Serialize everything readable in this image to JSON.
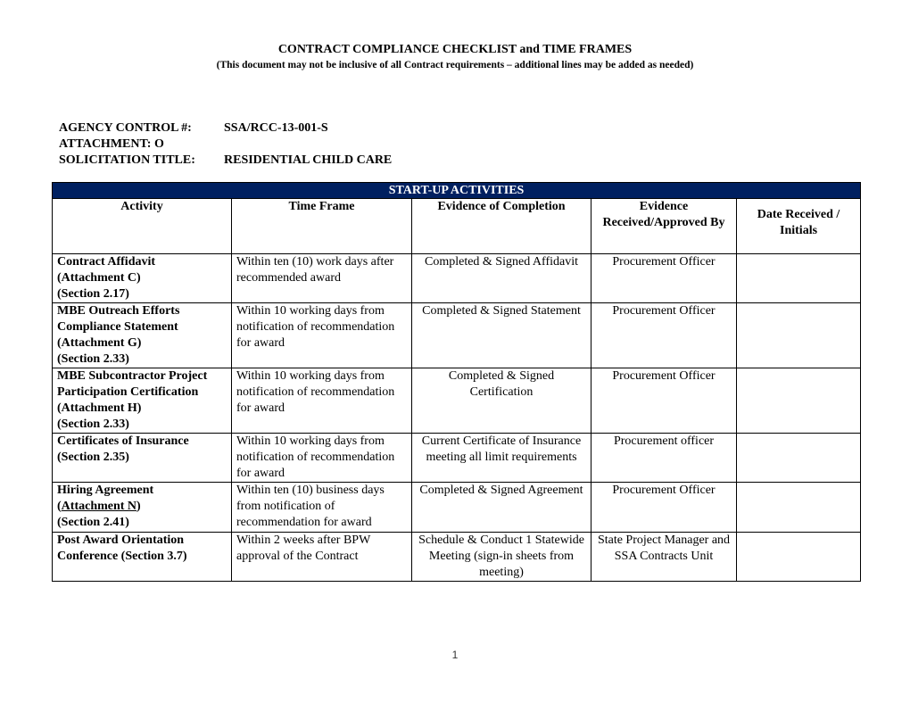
{
  "document": {
    "title": "CONTRACT COMPLIANCE CHECKLIST and TIME FRAMES",
    "subtitle": "(This document may not be inclusive of all Contract requirements – additional lines may be added as needed)",
    "page_number": "1"
  },
  "meta": {
    "agency_control_label": "AGENCY CONTROL #:",
    "agency_control_value": "SSA/RCC-13-001-S",
    "attachment_label": "ATTACHMENT: O",
    "solicitation_title_label": "SOLICITATION TITLE:",
    "solicitation_title_value": "RESIDENTIAL CHILD CARE"
  },
  "table": {
    "section_title": "START-UP ACTIVITIES",
    "section_color": "#002060",
    "headers": {
      "activity": "Activity",
      "time_frame": "Time Frame",
      "evidence": "Evidence of Completion",
      "received_by": "Evidence Received/Approved By",
      "date_received": "Date Received / Initials"
    },
    "rows": [
      {
        "activity": [
          "Contract Affidavit",
          "(Attachment C)",
          "(Section 2.17)"
        ],
        "time_frame": "Within ten (10) work days after recommended award",
        "evidence": "Completed & Signed Affidavit",
        "received_by": "Procurement Officer",
        "date_received": ""
      },
      {
        "activity": [
          "MBE Outreach Efforts Compliance Statement",
          "(Attachment G)",
          "(Section 2.33)"
        ],
        "time_frame": "Within 10 working days from notification of recommendation for award",
        "evidence": "Completed & Signed Statement",
        "received_by": "Procurement Officer",
        "date_received": ""
      },
      {
        "activity": [
          "MBE Subcontractor Project Participation Certification",
          "(Attachment H)",
          "(Section 2.33)"
        ],
        "time_frame": "Within 10 working days from notification of recommendation for award",
        "evidence": "Completed & Signed Certification",
        "received_by": "Procurement Officer",
        "date_received": ""
      },
      {
        "activity": [
          "Certificates of Insurance",
          "(Section 2.35)"
        ],
        "time_frame": "Within 10 working days from notification of recommendation for award",
        "evidence": "Current Certificate of Insurance meeting all limit requirements",
        "received_by": "Procurement officer",
        "date_received": ""
      },
      {
        "activity": [
          "Hiring Agreement",
          "(Attachment N)",
          "(Section 2.41)"
        ],
        "time_frame": "Within ten (10) business days from notification of recommendation for award",
        "evidence": "Completed & Signed Agreement",
        "received_by": "Procurement Officer",
        "date_received": ""
      },
      {
        "activity": [
          "Post Award Orientation Conference (Section 3.7)"
        ],
        "time_frame": "Within 2 weeks after BPW approval of the Contract",
        "evidence": "Schedule & Conduct 1 Statewide Meeting (sign-in sheets from meeting)",
        "received_by": "State Project Manager and SSA Contracts Unit",
        "date_received": ""
      }
    ]
  }
}
